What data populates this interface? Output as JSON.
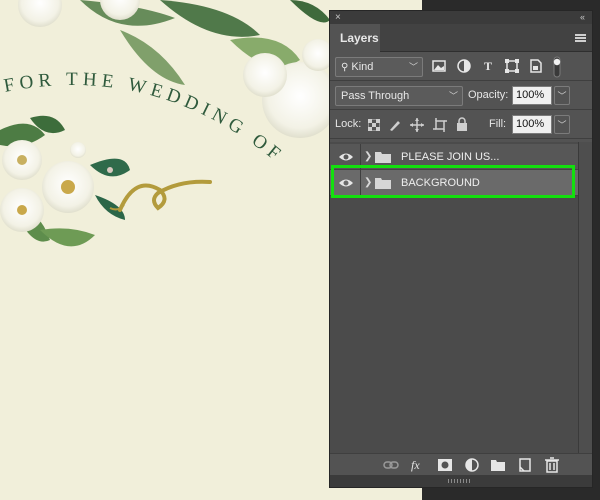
{
  "artwork": {
    "arc_text": "FOR THE WEDDING OF",
    "text_color": "#2f5a3c",
    "paper_color": "#f1efda",
    "flourish_color": "#b39b3c"
  },
  "panel": {
    "close_glyph": "×",
    "collapse_glyph": "‹‹",
    "tab_label": "Layers",
    "filter": {
      "label": "Kind"
    },
    "blend_mode": {
      "value": "Pass Through"
    },
    "opacity": {
      "label": "Opacity:",
      "value": "100%"
    },
    "lock": {
      "label": "Lock:"
    },
    "fill": {
      "label": "Fill:",
      "value": "100%"
    },
    "layers": [
      {
        "name": "PLEASE JOIN US...",
        "type": "group",
        "visible": true,
        "selected": false
      },
      {
        "name": "BACKGROUND",
        "type": "group",
        "visible": true,
        "selected": true
      }
    ],
    "footer_icons": [
      "link-icon",
      "fx-icon",
      "mask-icon",
      "adjustment-icon",
      "folder-icon",
      "new-layer-icon",
      "trash-icon"
    ]
  },
  "colors": {
    "panel_bg": "#535353",
    "selected_row": "#6a6a6a",
    "highlight": "#13e00e"
  }
}
